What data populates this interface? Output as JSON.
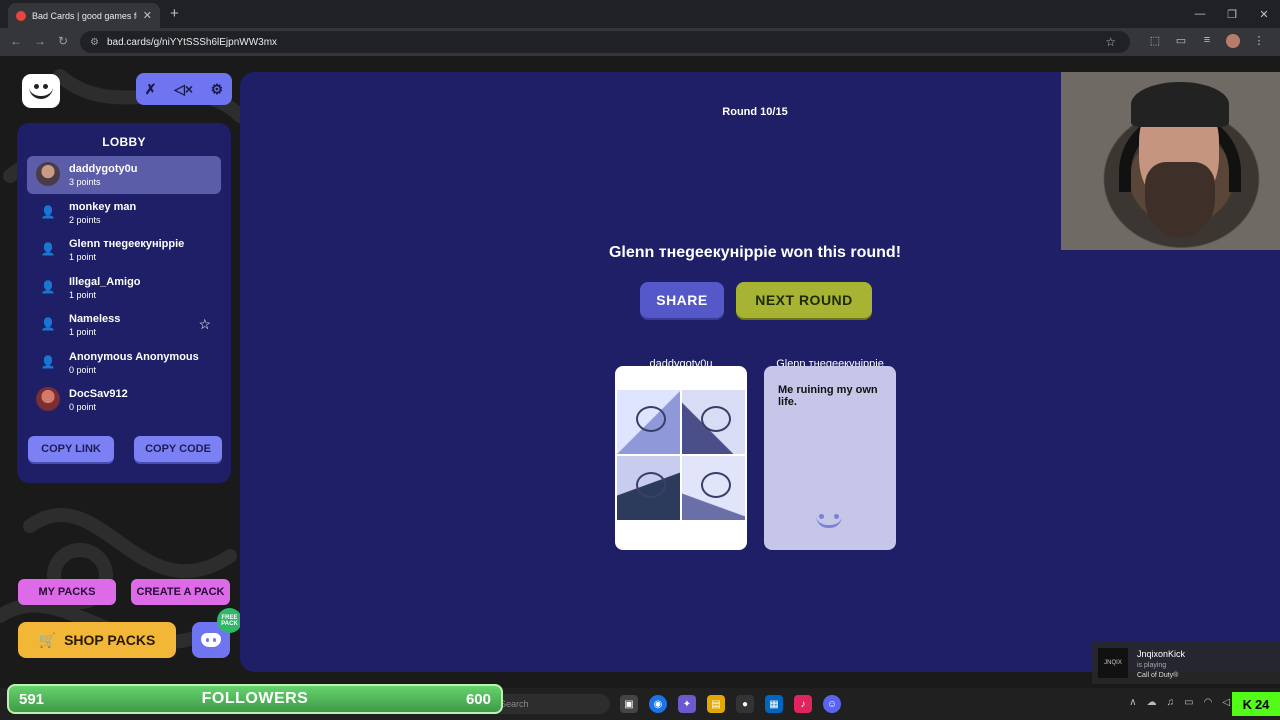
{
  "browser": {
    "tab_title": "Bad Cards | good games for yo",
    "url": "bad.cards/g/niYYtSSSh6lEjpnWW3mx"
  },
  "lobby": {
    "title": "LOBBY",
    "players": [
      {
        "name": "daddygoty0u",
        "points": "3 points"
      },
      {
        "name": "monkey man",
        "points": "2 points"
      },
      {
        "name": "Glenn тнegeeкyнippie",
        "points": "1 point"
      },
      {
        "name": "Illegal_Amigo",
        "points": "1 point"
      },
      {
        "name": "Nameless",
        "points": "1 point"
      },
      {
        "name": "Anonymous Anonymous",
        "points": "0 point"
      },
      {
        "name": "DocSav912",
        "points": "0 point"
      }
    ],
    "copy_link": "COPY LINK",
    "copy_code": "COPY CODE"
  },
  "packs": {
    "my_packs": "MY PACKS",
    "create_pack": "CREATE A PACK",
    "shop_packs": "SHOP PACKS",
    "free_badge": "FREE PACK"
  },
  "game": {
    "round": "Round 10/15",
    "winner_text": "Glenn тнegeeкyнippie won this round!",
    "share": "SHARE",
    "next_round": "NEXT ROUND",
    "cards": [
      {
        "player": "daddygoty0u",
        "type": "image"
      },
      {
        "player": "Glenn тнegeeкyнippie",
        "text": "Me ruining my own life."
      }
    ]
  },
  "overlay": {
    "followers_current": "591",
    "followers_label": "FOLLOWERS",
    "followers_goal": "600",
    "now_playing_user": "JnqixonKick",
    "now_playing_status": "is playing",
    "now_playing_game": "Call of Duty®",
    "now_playing_art": "JNQIX",
    "kick_count": "24"
  },
  "taskbar": {
    "search_placeholder": "Search"
  }
}
